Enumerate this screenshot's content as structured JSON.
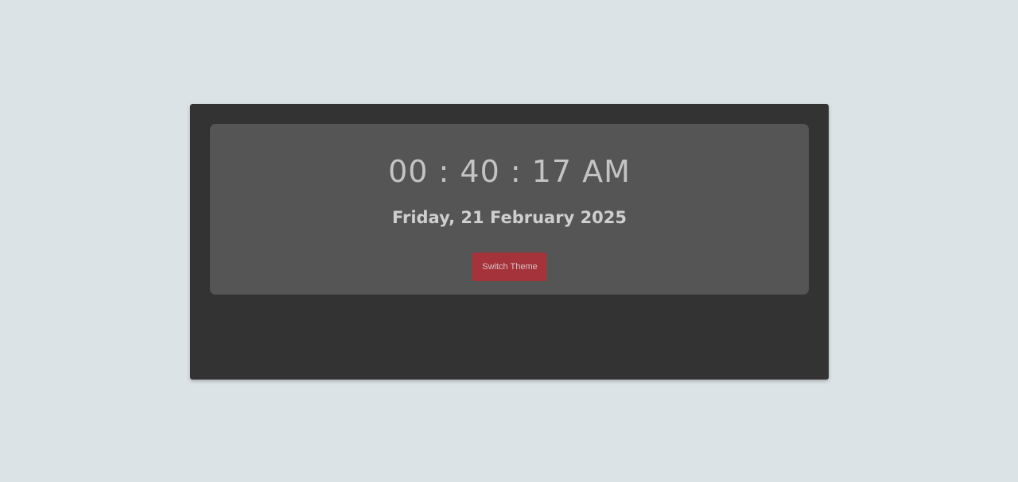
{
  "clock": {
    "time": "00 : 40 : 17 AM",
    "date": "Friday, 21 February 2025"
  },
  "controls": {
    "switch_theme_label": "Switch Theme"
  },
  "colors": {
    "page_background": "#dce3e7",
    "card_background": "#333333",
    "panel_background": "#555555",
    "accent_button": "#a5333b",
    "clock_text": "#c4c4c4"
  }
}
